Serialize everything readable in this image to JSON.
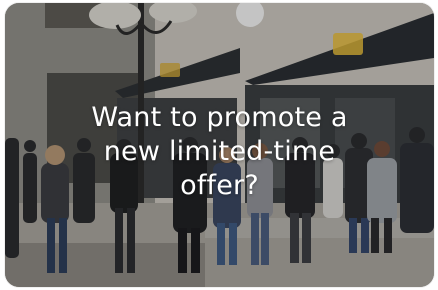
{
  "promo_card": {
    "headline_lines": [
      "Want to promote a",
      "new limited-time",
      "offer?"
    ]
  }
}
